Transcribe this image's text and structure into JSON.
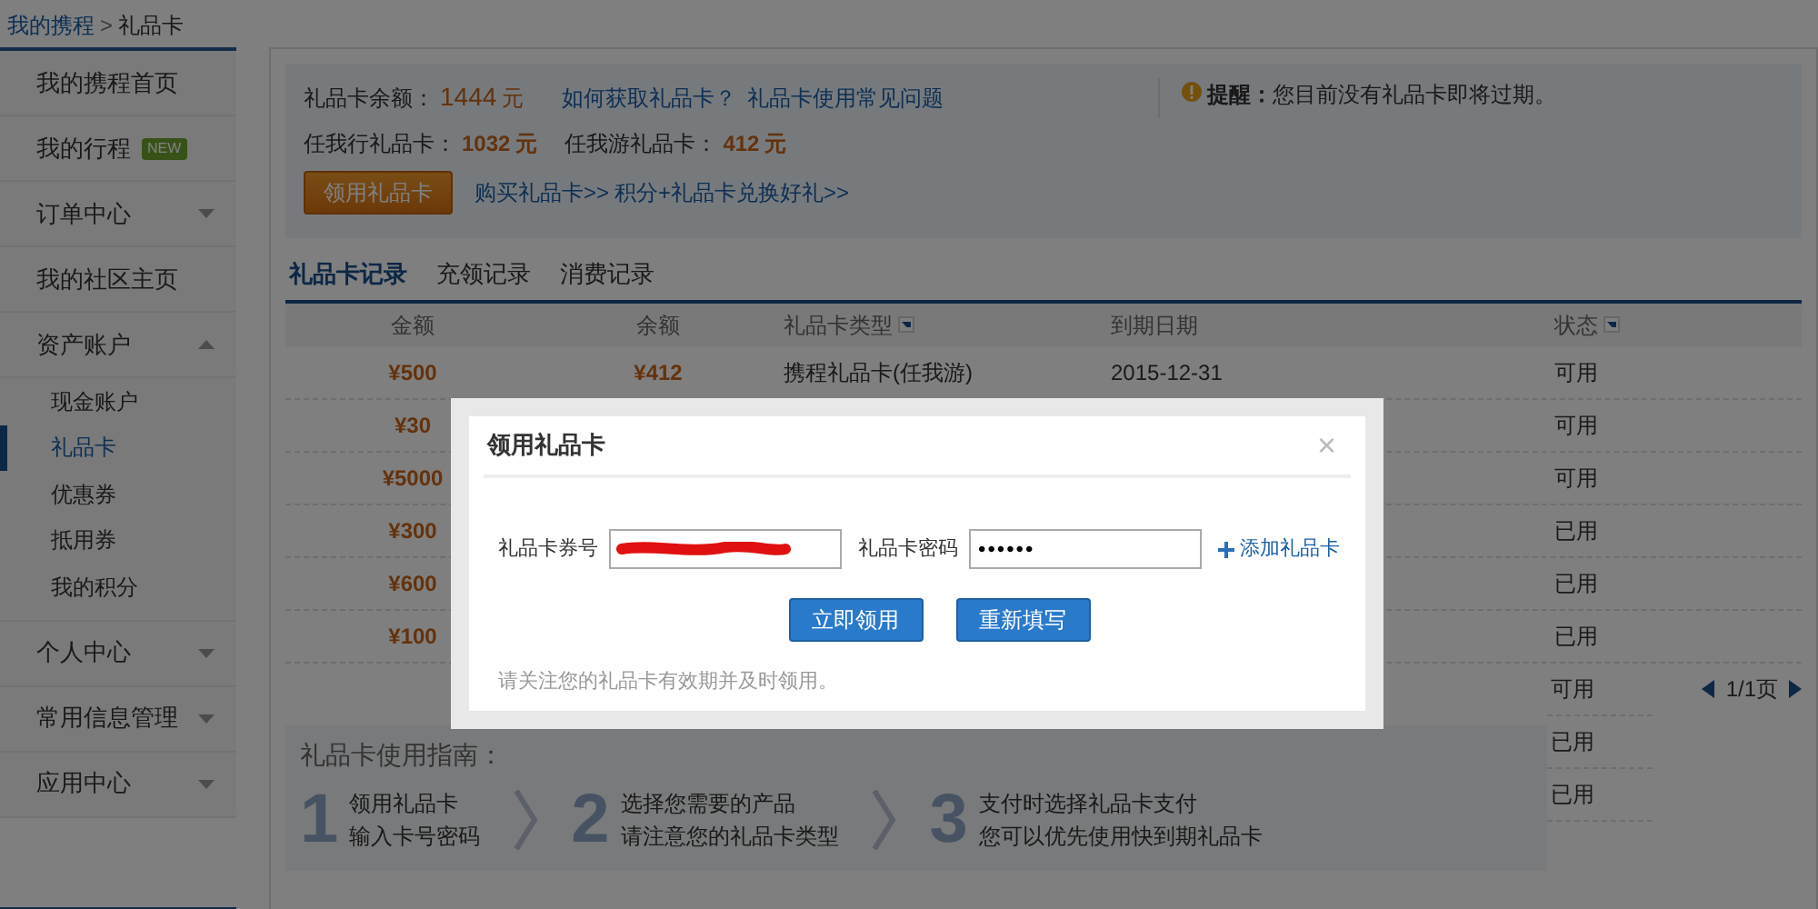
{
  "breadcrumb": {
    "items": [
      "我的携程",
      "礼品卡"
    ],
    "separator": ">"
  },
  "sidebar": {
    "items": [
      {
        "label": "我的携程首页"
      },
      {
        "label": "我的行程",
        "badge": "NEW"
      },
      {
        "label": "订单中心",
        "expanded": false
      },
      {
        "label": "我的社区主页"
      },
      {
        "label": "资产账户",
        "expanded": true,
        "children": [
          {
            "label": "现金账户",
            "selected": false
          },
          {
            "label": "礼品卡",
            "selected": true
          },
          {
            "label": "优惠券",
            "selected": false
          },
          {
            "label": "抵用券",
            "selected": false
          },
          {
            "label": "我的积分",
            "selected": false
          }
        ]
      },
      {
        "label": "个人中心",
        "expanded": false
      },
      {
        "label": "常用信息管理",
        "expanded": false
      },
      {
        "label": "应用中心",
        "expanded": false
      }
    ]
  },
  "summary": {
    "balance_label": "礼品卡余额：",
    "balance_amount": "1444",
    "balance_unit": "元",
    "help_links": [
      "如何获取礼品卡？",
      "礼品卡使用常见问题"
    ],
    "sub_balances": [
      {
        "label": "任我行礼品卡：",
        "amount": "1032",
        "unit": "元"
      },
      {
        "label": "任我游礼品卡：",
        "amount": "412",
        "unit": "元"
      }
    ],
    "claim_button": "领用礼品卡",
    "promo_links": [
      "购买礼品卡>>",
      "积分+礼品卡兑换好礼>>"
    ],
    "reminder": "**提醒：**您目前没有礼品卡即将过期。"
  },
  "tabs": [
    {
      "label": "礼品卡记录",
      "selected": true
    },
    {
      "label": "充领记录",
      "selected": false
    },
    {
      "label": "消费记录",
      "selected": false
    }
  ],
  "table": {
    "columns": [
      {
        "label": "金额",
        "sortable": false
      },
      {
        "label": "余额",
        "sortable": false
      },
      {
        "label": "礼品卡类型",
        "sortable": true
      },
      {
        "label": "到期日期",
        "sortable": false
      },
      {
        "label": "状态",
        "sortable": true
      }
    ],
    "rows": [
      {
        "amount": "¥500",
        "balance": "¥412",
        "type": "携程礼品卡(任我游)",
        "expiry": "2015-12-31",
        "status": "可用"
      },
      {
        "amount": "¥30",
        "status": "可用"
      },
      {
        "amount": "¥5000",
        "status": "可用"
      },
      {
        "amount": "¥300",
        "status": "已用"
      },
      {
        "amount": "¥600",
        "status": "已用"
      },
      {
        "amount": "¥100",
        "status": "已用"
      },
      {
        "status": "可用"
      },
      {
        "status": "已用"
      },
      {
        "status": "已用"
      }
    ]
  },
  "pagination": {
    "text": "1/1页"
  },
  "guide": {
    "title": "礼品卡使用指南：",
    "steps": [
      {
        "number": "1",
        "lines": [
          "领用礼品卡",
          "输入卡号密码"
        ]
      },
      {
        "number": "2",
        "lines": [
          "选择您需要的产品",
          "请注意您的礼品卡类型"
        ]
      },
      {
        "number": "3",
        "lines": [
          "支付时选择礼品卡支付",
          "您可以优先使用快到期礼品卡"
        ]
      }
    ]
  },
  "dialog": {
    "title": "领用礼品卡",
    "close": "×",
    "fields": [
      {
        "label": "礼品卡券号",
        "kind": "card_number",
        "redacted": true
      },
      {
        "label": "礼品卡密码",
        "kind": "password",
        "value": "••••••",
        "redacted": false
      }
    ],
    "add_link": "添加礼品卡",
    "buttons": [
      "立即领用",
      "重新填写"
    ],
    "note": "请关注您的礼品卡有效期并及时领用。"
  }
}
